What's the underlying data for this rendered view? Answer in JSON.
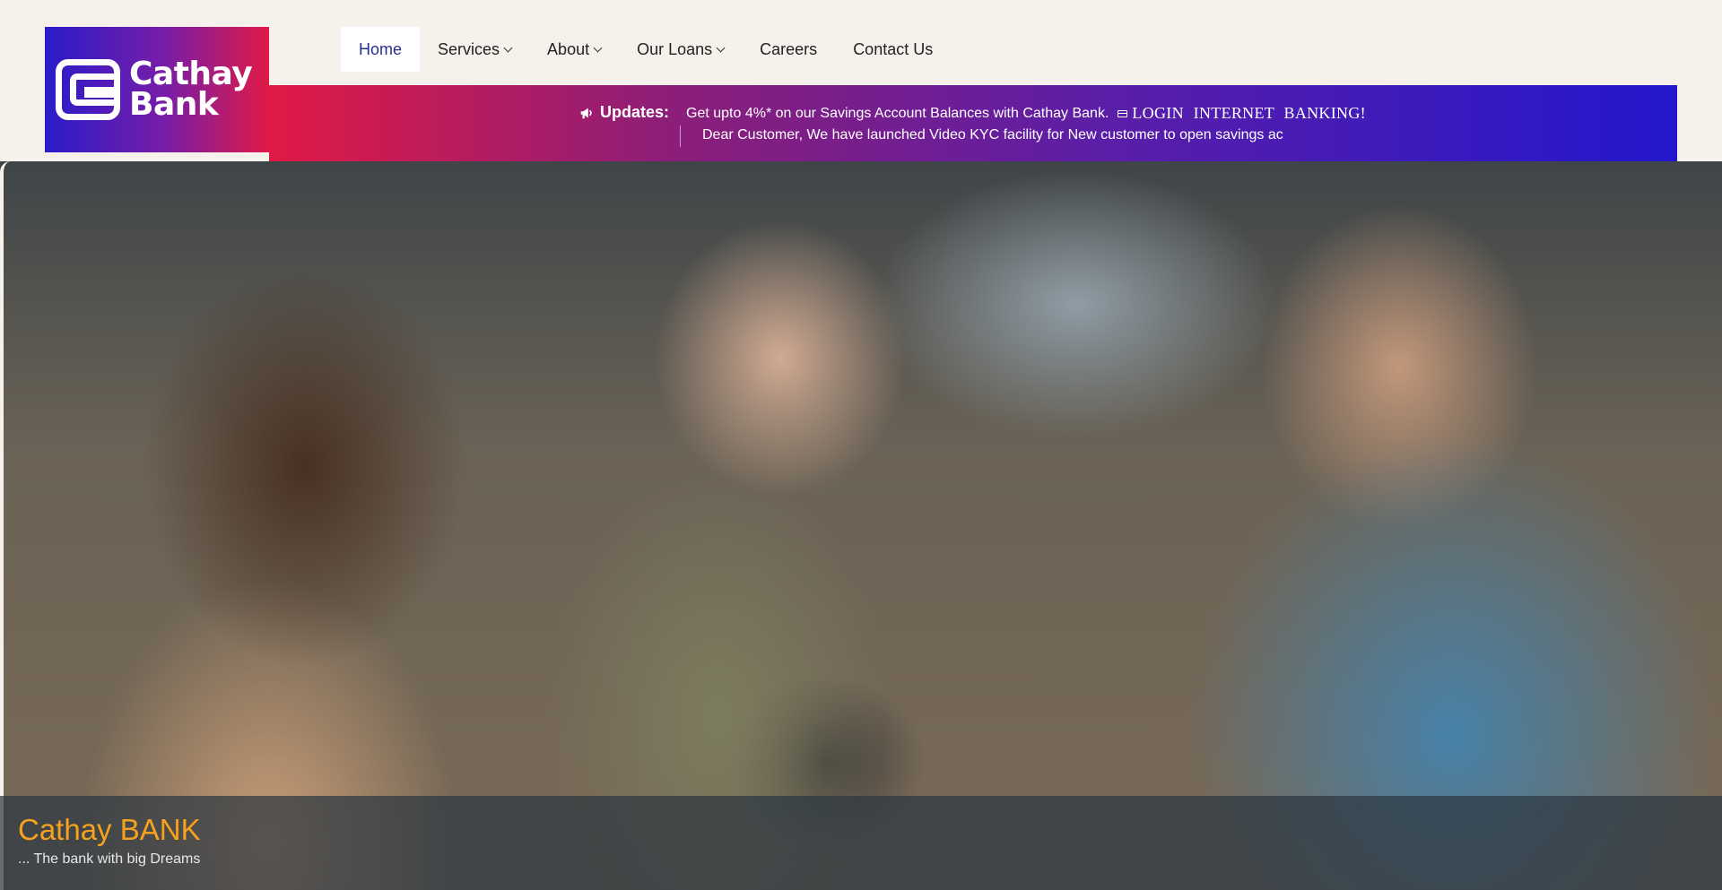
{
  "logo": {
    "line1": "Cathay",
    "line2": "Bank",
    "icon": "cathay-logo-mark"
  },
  "nav": {
    "items": [
      {
        "label": "Home",
        "active": true,
        "has_dropdown": false
      },
      {
        "label": "Services",
        "active": false,
        "has_dropdown": true
      },
      {
        "label": "About",
        "active": false,
        "has_dropdown": true
      },
      {
        "label": "Our Loans",
        "active": false,
        "has_dropdown": true
      },
      {
        "label": "Careers",
        "active": false,
        "has_dropdown": false
      },
      {
        "label": "Contact Us",
        "active": false,
        "has_dropdown": false
      }
    ]
  },
  "updates": {
    "label": "Updates:",
    "icon": "megaphone-icon",
    "line1": "Get upto 4%* on our Savings Account Balances with Cathay Bank.",
    "login_link": "LOGIN INTERNET BANKING!",
    "line2": "Dear Customer, We have launched Video KYC facility for New customer to open savings ac"
  },
  "hero": {
    "title": "Cathay BANK",
    "subtitle": "... The bank with big Dreams"
  },
  "colors": {
    "brand_blue": "#2317cc",
    "brand_red": "#e01a45",
    "hero_title": "#f6a21e",
    "nav_active": "#2b2f8c",
    "background": "#f7f1ec"
  }
}
